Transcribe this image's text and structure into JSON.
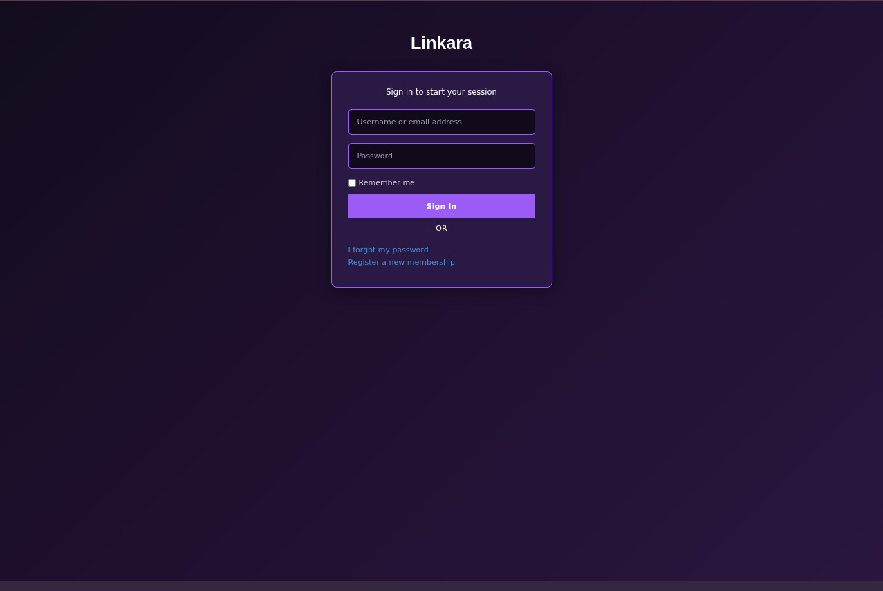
{
  "brand": "Linkara",
  "card": {
    "title": "Sign in to start your session",
    "username": {
      "placeholder": "Username or email address"
    },
    "password": {
      "placeholder": "Password"
    },
    "remember": {
      "label": "Remember me",
      "checked": false
    },
    "submit": "Sign In",
    "divider": "- OR -",
    "links": [
      "I forgot my password",
      "Register a new membership"
    ]
  }
}
